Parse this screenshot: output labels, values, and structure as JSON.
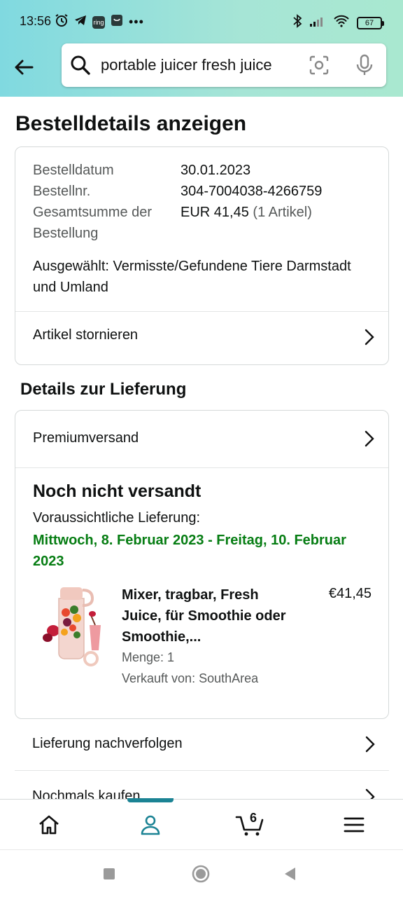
{
  "status_bar": {
    "time": "13:56",
    "app_icon_1": "ring",
    "battery": "67"
  },
  "search": {
    "query": "portable juicer fresh juice"
  },
  "page": {
    "title": "Bestelldetails anzeigen"
  },
  "order": {
    "date_label": "Bestelldatum",
    "date_value": "30.01.2023",
    "number_label": "Bestellnr.",
    "number_value": "304-7004038-4266759",
    "total_label": "Gesamtsumme der Bestellung",
    "total_value": "EUR 41,45",
    "total_items": "(1 Artikel)",
    "selected": "Ausgewählt: Vermisste/Gefundene Tiere Darmstadt und Umland",
    "cancel_label": "Artikel stornieren"
  },
  "delivery": {
    "section_title": "Details zur Lieferung",
    "shipping_method": "Premiumversand",
    "status": "Noch nicht versandt",
    "eta_label": "Voraussichtliche Lieferung:",
    "eta_dates": "Mittwoch, 8. Februar 2023 - Freitag, 10. Februar 2023",
    "product": {
      "title": "Mixer, tragbar, Fresh Juice, für Smoothie oder Smoothie,...",
      "price": "€41,45",
      "quantity": "Menge: 1",
      "seller": "Verkauft von: SouthArea"
    }
  },
  "actions": {
    "track": "Lieferung nachverfolgen",
    "buy_again": "Nochmals kaufen"
  },
  "bottom_nav": {
    "cart_count": "6"
  },
  "colors": {
    "header_gradient_start": "#80d9e0",
    "header_gradient_end": "#a9e8d0",
    "delivery_green": "#067d13",
    "nav_active": "#1b8394"
  }
}
